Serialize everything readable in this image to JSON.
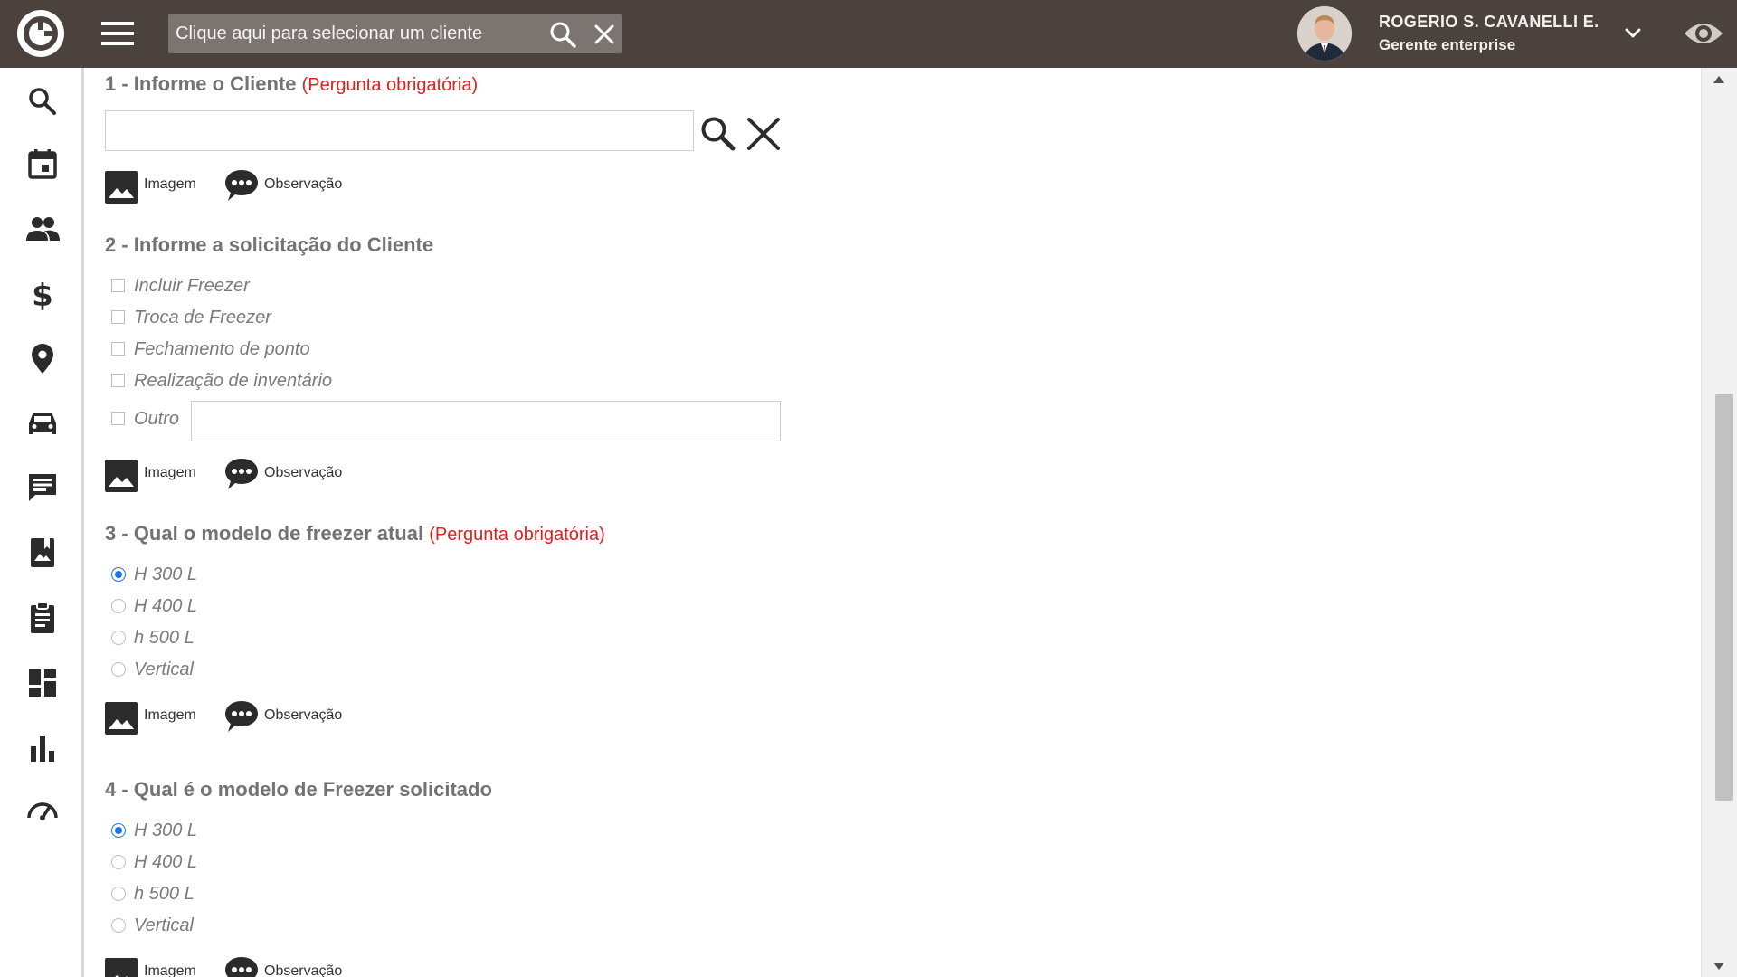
{
  "header": {
    "search": {
      "placeholder": "Clique aqui para selecionar um cliente"
    },
    "user": {
      "name": "ROGERIO S. CAVANELLI E.",
      "role": "Gerente enterprise"
    }
  },
  "sidebar": {
    "items": [
      {
        "icon": "search-icon"
      },
      {
        "icon": "calendar-icon"
      },
      {
        "icon": "people-icon"
      },
      {
        "icon": "dollar-icon"
      },
      {
        "icon": "location-pin-icon"
      },
      {
        "icon": "car-icon"
      },
      {
        "icon": "message-icon"
      },
      {
        "icon": "photo-book-icon"
      },
      {
        "icon": "clipboard-icon"
      },
      {
        "icon": "dashboard-icon"
      },
      {
        "icon": "bar-chart-icon"
      },
      {
        "icon": "speedometer-icon"
      }
    ]
  },
  "form": {
    "attach_image_label": "Imagem",
    "attach_obs_label": "Observação",
    "questions": [
      {
        "title": "1 - Informe o Cliente",
        "required": "(Pergunta obrigatória)"
      },
      {
        "title": "2 - Informe a solicitação do Cliente",
        "options": [
          "Incluir Freezer",
          "Troca de Freezer",
          "Fechamento de ponto",
          "Realização de inventário",
          "Outro"
        ]
      },
      {
        "title": "3 - Qual o modelo de freezer atual",
        "required": "(Pergunta obrigatória)",
        "options": [
          "H 300 L",
          "H 400 L",
          "h 500 L",
          "Vertical"
        ],
        "selected": "H 300 L"
      },
      {
        "title": "4 - Qual é o modelo de Freezer solicitado",
        "options": [
          "H 300 L",
          "H 400 L",
          "h 500 L",
          "Vertical"
        ],
        "selected": "H 300 L"
      }
    ]
  },
  "colors": {
    "topbar": "#4b423e",
    "search_box": "#7b7471",
    "required": "#e02020",
    "radio_selected": "#1a73e8",
    "question_text": "#737373"
  }
}
